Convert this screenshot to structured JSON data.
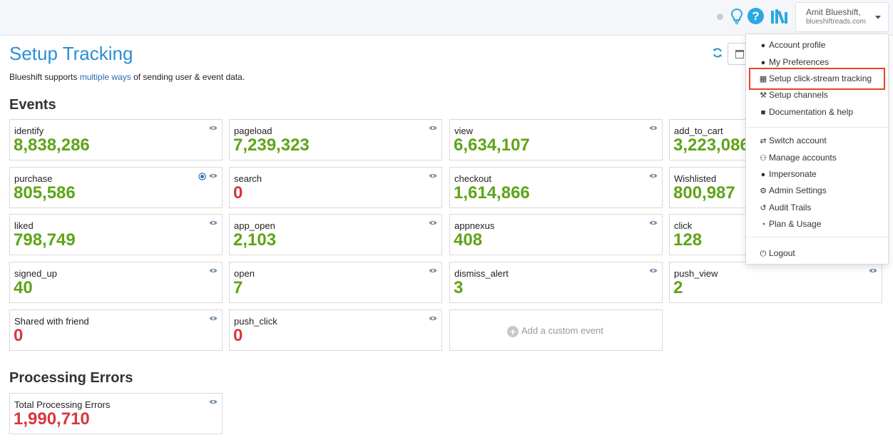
{
  "header": {
    "user_name": "Amit Blueshift,",
    "user_org": "blueshiftreads.com",
    "help_symbol": "?",
    "icons": [
      "status-dot-icon",
      "lightbulb-icon",
      "help-icon",
      "library-icon",
      "chevron-down-icon"
    ]
  },
  "page": {
    "title": "Setup Tracking",
    "subtitle_before": "Blueshift supports ",
    "subtitle_link": "multiple ways",
    "subtitle_after": " of sending user & event data."
  },
  "events_section": {
    "title": "Events",
    "cards": [
      {
        "label": "identify",
        "value": "8,838,286",
        "status": "green"
      },
      {
        "label": "pageload",
        "value": "7,239,323",
        "status": "green"
      },
      {
        "label": "view",
        "value": "6,634,107",
        "status": "green"
      },
      {
        "label": "add_to_cart",
        "value": "3,223,086",
        "status": "green"
      },
      {
        "label": "purchase",
        "value": "805,586",
        "status": "green"
      },
      {
        "label": "search",
        "value": "0",
        "status": "red"
      },
      {
        "label": "checkout",
        "value": "1,614,866",
        "status": "green"
      },
      {
        "label": "Wishlisted",
        "value": "800,987",
        "status": "green"
      },
      {
        "label": "liked",
        "value": "798,749",
        "status": "green"
      },
      {
        "label": "app_open",
        "value": "2,103",
        "status": "green"
      },
      {
        "label": "appnexus",
        "value": "408",
        "status": "green"
      },
      {
        "label": "click",
        "value": "128",
        "status": "green"
      },
      {
        "label": "signed_up",
        "value": "40",
        "status": "green"
      },
      {
        "label": "open",
        "value": "7",
        "status": "green"
      },
      {
        "label": "dismiss_alert",
        "value": "3",
        "status": "green"
      },
      {
        "label": "push_view",
        "value": "2",
        "status": "green"
      },
      {
        "label": "Shared with friend",
        "value": "0",
        "status": "red"
      },
      {
        "label": "push_click",
        "value": "0",
        "status": "red"
      }
    ],
    "add_custom_label": "Add a custom event"
  },
  "errors_section": {
    "title": "Processing Errors",
    "card": {
      "label": "Total Processing Errors",
      "value": "1,990,710",
      "status": "red"
    }
  },
  "user_menu": {
    "items": [
      {
        "label": "Account profile",
        "icon": "user-icon"
      },
      {
        "label": "My Preferences",
        "icon": "user-icon"
      },
      {
        "label": "Setup click-stream tracking",
        "icon": "calendar-icon"
      },
      {
        "label": "Setup channels",
        "icon": "wrench-icon"
      },
      {
        "label": "Documentation & help",
        "icon": "archive-icon"
      },
      {
        "label": "Switch account",
        "icon": "exchange-icon"
      },
      {
        "label": "Manage accounts",
        "icon": "users-icon"
      },
      {
        "label": "Impersonate",
        "icon": "user-icon"
      },
      {
        "label": "Admin Settings",
        "icon": "gear-icon"
      },
      {
        "label": "Audit Trails",
        "icon": "history-icon"
      },
      {
        "label": "Plan & Usage",
        "icon": "pie-chart-icon"
      },
      {
        "label": "Logout",
        "icon": "power-icon"
      }
    ],
    "highlighted_item": "Setup click-stream tracking"
  },
  "colors": {
    "title_blue": "#2b8fd6",
    "value_green": "#5fa418",
    "value_red": "#d9363e",
    "highlight_red": "#e8412c"
  }
}
